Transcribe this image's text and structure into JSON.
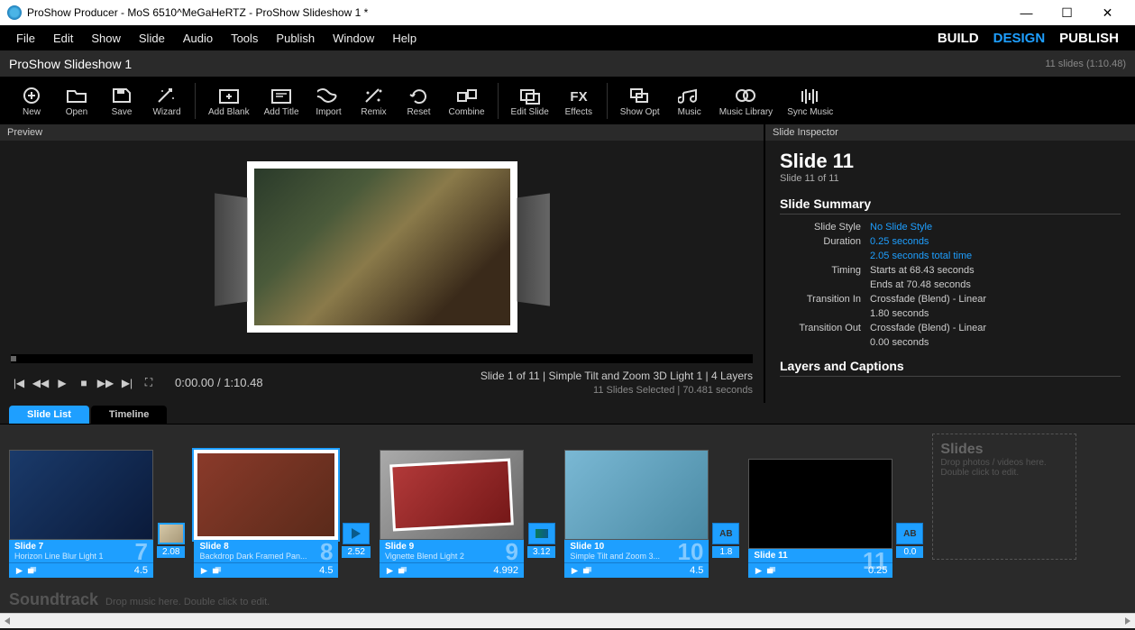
{
  "titlebar": {
    "title": "ProShow Producer - MoS 6510^MeGaHeRTZ - ProShow Slideshow 1 *",
    "min": "—",
    "max": "☐",
    "close": "✕"
  },
  "menubar": [
    "File",
    "Edit",
    "Show",
    "Slide",
    "Audio",
    "Tools",
    "Publish",
    "Window",
    "Help"
  ],
  "modes": {
    "build": "BUILD",
    "design": "DESIGN",
    "publish": "PUBLISH"
  },
  "infobar": {
    "title": "ProShow Slideshow 1",
    "right": "11 slides (1:10.48)"
  },
  "toolbar": [
    {
      "id": "new",
      "label": "New"
    },
    {
      "id": "open",
      "label": "Open"
    },
    {
      "id": "save",
      "label": "Save"
    },
    {
      "id": "wizard",
      "label": "Wizard"
    },
    {
      "sep": true
    },
    {
      "id": "addblank",
      "label": "Add Blank"
    },
    {
      "id": "addtitle",
      "label": "Add Title"
    },
    {
      "id": "import",
      "label": "Import"
    },
    {
      "id": "remix",
      "label": "Remix"
    },
    {
      "id": "reset",
      "label": "Reset"
    },
    {
      "id": "combine",
      "label": "Combine"
    },
    {
      "sep": true
    },
    {
      "id": "editslide",
      "label": "Edit Slide"
    },
    {
      "id": "effects",
      "label": "Effects"
    },
    {
      "sep": true
    },
    {
      "id": "showopt",
      "label": "Show Opt"
    },
    {
      "id": "music",
      "label": "Music"
    },
    {
      "id": "musiclib",
      "label": "Music Library"
    },
    {
      "id": "syncmusic",
      "label": "Sync Music"
    }
  ],
  "preview": {
    "header": "Preview",
    "time": "0:00.00 / 1:10.48",
    "slide_info": "Slide 1 of 11  |  Simple Tilt and Zoom 3D Light 1  |  4 Layers",
    "selection_info": "11 Slides Selected  |  70.481 seconds"
  },
  "inspector": {
    "header": "Slide Inspector",
    "title": "Slide 11",
    "subtitle": "Slide 11 of 11",
    "summary_title": "Slide Summary",
    "rows": {
      "style_label": "Slide Style",
      "style_value": "No Slide Style",
      "duration_label": "Duration",
      "duration_value1": "0.25 seconds",
      "duration_value2": "2.05 seconds total time",
      "timing_label": "Timing",
      "timing_value1": "Starts at 68.43 seconds",
      "timing_value2": "Ends at 70.48 seconds",
      "trans_in_label": "Transition In",
      "trans_in_value1": "Crossfade (Blend) - Linear",
      "trans_in_value2": "1.80 seconds",
      "trans_out_label": "Transition Out",
      "trans_out_value1": "Crossfade (Blend) - Linear",
      "trans_out_value2": "0.00 seconds"
    },
    "layers_title": "Layers and Captions"
  },
  "tabs": {
    "slide_list": "Slide List",
    "timeline": "Timeline"
  },
  "slides": [
    {
      "num": "7",
      "name": "Slide 7",
      "style": "Horizon Line Blur Light 1",
      "dur": "4.5",
      "thumb": "t1",
      "pre_trans": {
        "type": "mini",
        "time": "2.08"
      }
    },
    {
      "num": "8",
      "name": "Slide 8",
      "style": "Backdrop Dark Framed Pan...",
      "dur": "4.5",
      "thumb": "t2",
      "pre_trans": {
        "type": "arrow",
        "time": "2.52"
      }
    },
    {
      "num": "9",
      "name": "Slide 9",
      "style": "Vignette Blend Light 2",
      "dur": "4.992",
      "thumb": "t3",
      "pre_trans": {
        "type": "box",
        "time": "3.12"
      }
    },
    {
      "num": "10",
      "name": "Slide 10",
      "style": "Simple Tilt and Zoom 3...",
      "dur": "4.5",
      "thumb": "t4",
      "pre_trans": {
        "type": "ab",
        "time": "1.8"
      }
    },
    {
      "num": "11",
      "name": "Slide 11",
      "style": "",
      "dur": "0.25",
      "thumb": "t5",
      "pre_trans": {
        "type": "ab",
        "time": "0.0"
      }
    }
  ],
  "dropzone": {
    "title": "Slides",
    "hint1": "Drop photos / videos here.",
    "hint2": "Double click to edit."
  },
  "soundtrack": {
    "title": "Soundtrack",
    "hint": "Drop music here.  Double click to edit."
  }
}
